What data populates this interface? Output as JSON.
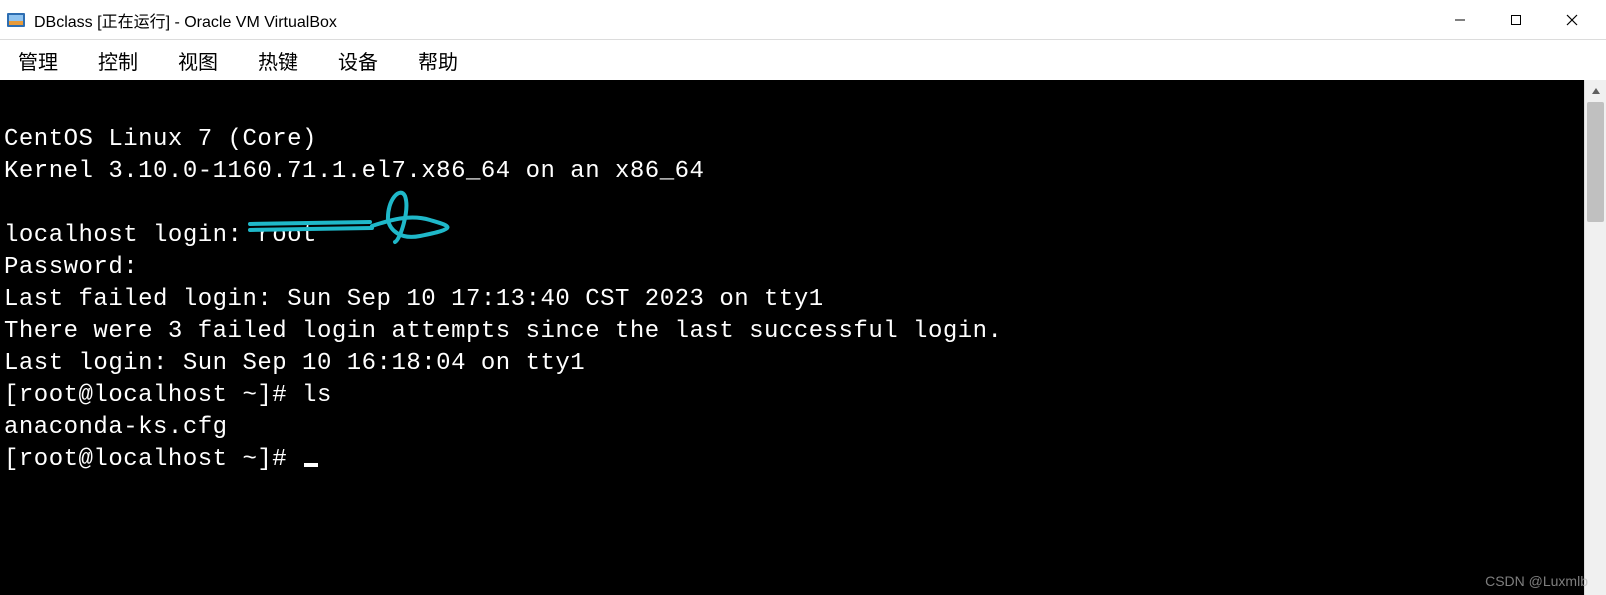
{
  "window": {
    "title": "DBclass [正在运行] - Oracle VM VirtualBox"
  },
  "menu": {
    "items": [
      "管理",
      "控制",
      "视图",
      "热键",
      "设备",
      "帮助"
    ]
  },
  "terminal": {
    "lines": [
      "CentOS Linux 7 (Core)",
      "Kernel 3.10.0-1160.71.1.el7.x86_64 on an x86_64",
      "",
      "localhost login: root",
      "Password:",
      "Last failed login: Sun Sep 10 17:13:40 CST 2023 on tty1",
      "There were 3 failed login attempts since the last successful login.",
      "Last login: Sun Sep 10 16:18:04 on tty1",
      "[root@localhost ~]# ls",
      "anaconda-ks.cfg",
      "[root@localhost ~]# "
    ]
  },
  "watermark": "CSDN @Luxmlb"
}
